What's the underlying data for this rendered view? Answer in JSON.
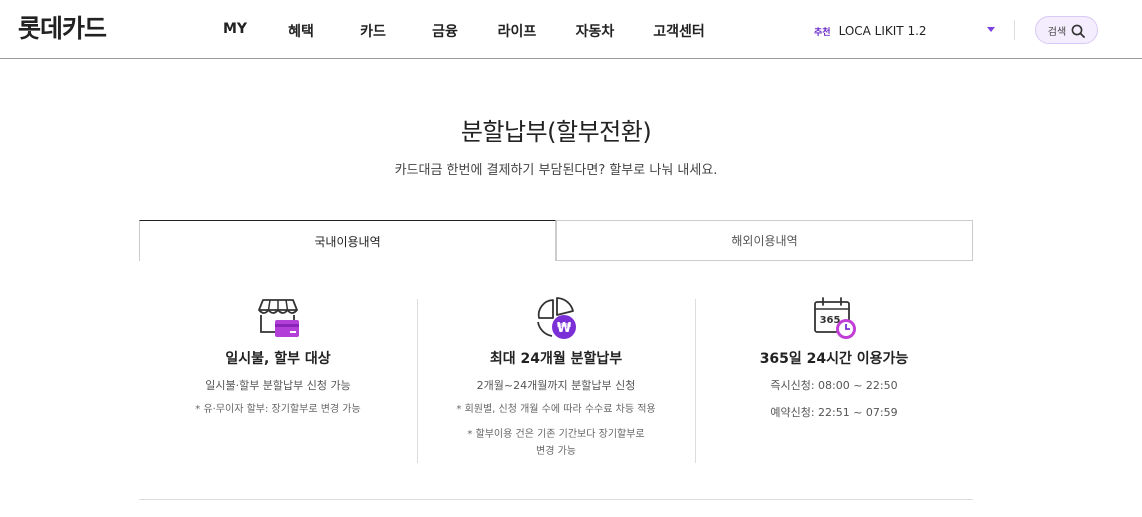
{
  "header": {
    "logo": "롯데카드",
    "nav": [
      "MY",
      "혜택",
      "카드",
      "금융",
      "라이프",
      "자동차",
      "고객센터"
    ],
    "reco_tag": "추천",
    "reco_text": "LOCA LIKIT 1.2",
    "search_label": "검색"
  },
  "page": {
    "title": "분할납부(할부전환)",
    "subtitle": "카드대금 한번에 결제하기 부담된다면? 할부로 나눠 내세요."
  },
  "tabs": [
    {
      "label": "국내이용내역",
      "active": true
    },
    {
      "label": "해외이용내역",
      "active": false
    }
  ],
  "features": [
    {
      "icon": "store-card-icon",
      "title": "일시불, 할부 대상",
      "desc": "일시불·할부 분할납부 신청 가능",
      "notes": [
        "* 유·무이자 할부: 장기할부로 변경 가능"
      ]
    },
    {
      "icon": "pie-won-icon",
      "title": "최대 24개월 분할납부",
      "desc": "2개월~24개월까지 분할납부 신청",
      "notes": [
        "* 회원별, 신청 개월 수에 따라 수수료 차등 적용",
        "* 할부이용 건은 기존 기간보다 장기할부로",
        "변경 가능"
      ]
    },
    {
      "icon": "calendar-365-icon",
      "title": "365일 24시간 이용가능",
      "desc": "즉시신청: 08:00 ~ 22:50",
      "notes": [
        "예약신청: 22:51 ~ 07:59"
      ]
    }
  ],
  "colors": {
    "accent": "#7b3fe4",
    "accent_pink": "#c13fd6",
    "text": "#222222"
  }
}
